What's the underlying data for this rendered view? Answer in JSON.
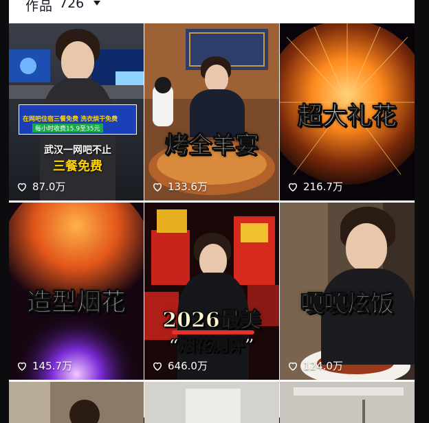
{
  "header": {
    "title": "作品",
    "count": "726"
  },
  "videos": [
    {
      "likes": "87.0万",
      "cover_lines": [
        "武汉一网吧不止",
        "三餐免费"
      ],
      "sub_lines": [
        "在网吧住宿三餐免费 洗衣烘干免费",
        "每小时收费15.9至35元"
      ]
    },
    {
      "likes": "133.6万",
      "cover_lines": [
        "烤全羊宴"
      ]
    },
    {
      "likes": "216.7万",
      "cover_lines": [
        "超大礼花"
      ]
    },
    {
      "likes": "145.7万",
      "cover_lines": [
        "造型烟花"
      ]
    },
    {
      "likes": "646.0万",
      "cover_lines": [
        "2026最美",
        "“烟花测评”"
      ]
    },
    {
      "likes": "124.0万",
      "cover_lines": [
        "嘎嘎炫饭"
      ]
    },
    {
      "likes": ""
    },
    {
      "likes": ""
    },
    {
      "likes": ""
    }
  ],
  "colors": {
    "accent_yellow": "#ffd400",
    "accent_red": "#e8312b",
    "firework_orange": "#ff8a1e",
    "firework_purple": "#7a2bd6"
  }
}
